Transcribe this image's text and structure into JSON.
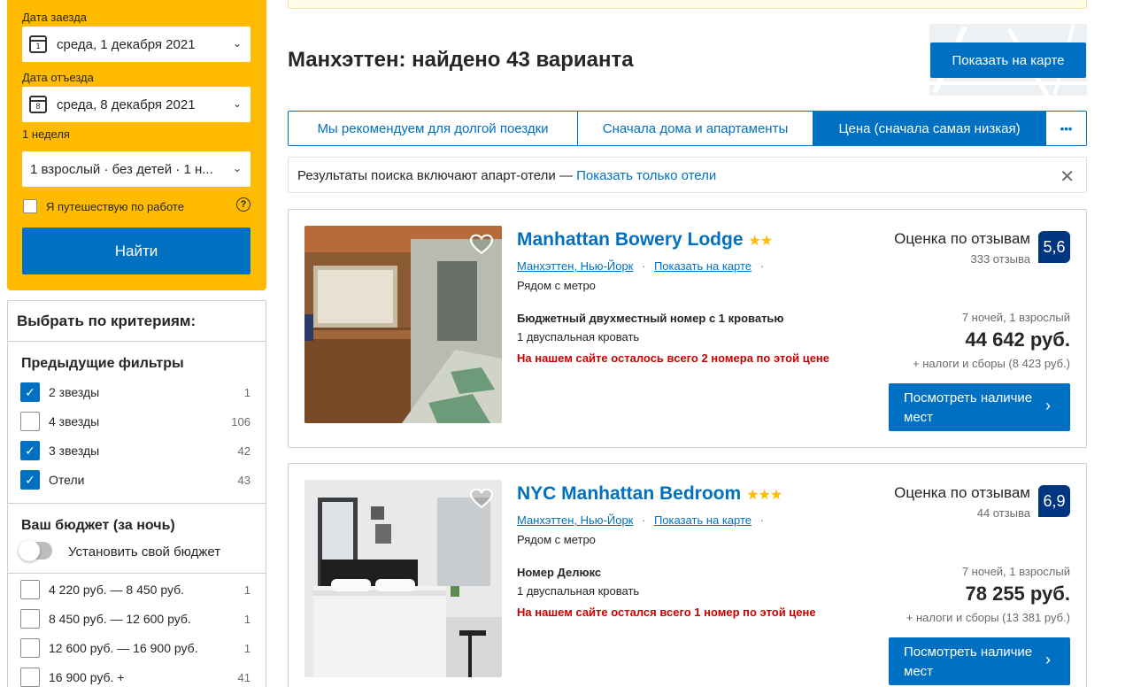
{
  "search": {
    "checkin_label": "Дата заезда",
    "checkin_value": "среда, 1 декабря 2021",
    "checkin_day": "1",
    "checkout_label": "Дата отъезда",
    "checkout_value": "среда, 8 декабря 2021",
    "checkout_day": "8",
    "duration": "1 неделя",
    "guests": "1 взрослый · без детей · 1 н...",
    "business_label": "Я путешествую по работе",
    "help": "?",
    "search_button": "Найти"
  },
  "filters": {
    "title": "Выбрать по критериям:",
    "previous_title": "Предыдущие фильтры",
    "previous": [
      {
        "label": "2 звезды",
        "count": "1",
        "checked": true
      },
      {
        "label": "4 звезды",
        "count": "106",
        "checked": false
      },
      {
        "label": "3 звезды",
        "count": "42",
        "checked": true
      },
      {
        "label": "Отели",
        "count": "43",
        "checked": true
      }
    ],
    "budget_title": "Ваш бюджет (за ночь)",
    "budget_toggle": "Установить свой бюджет",
    "budget": [
      {
        "label": "4 220 руб. — 8 450 руб.",
        "count": "1",
        "checked": false
      },
      {
        "label": "8 450 руб. — 12 600 руб.",
        "count": "1",
        "checked": false
      },
      {
        "label": "12 600 руб. — 16 900 руб.",
        "count": "1",
        "checked": false
      },
      {
        "label": "16 900 руб. +",
        "count": "41",
        "checked": false
      }
    ]
  },
  "header": {
    "title": "Манхэттен: найдено 43 варианта",
    "map_button": "Показать на карте"
  },
  "sort": {
    "tabs": [
      {
        "label": "Мы рекомендуем для долгой поездки"
      },
      {
        "label": "Сначала дома и апартаменты"
      },
      {
        "label": "Цена (сначала самая низкая)"
      },
      {
        "label": "•••"
      }
    ],
    "active_index": 2
  },
  "notice": {
    "text": "Результаты поиска включают апарт-отели — ",
    "link": "Показать только отели",
    "close": "✕"
  },
  "hotels": [
    {
      "name": "Manhattan Bowery Lodge",
      "stars": "★★",
      "district": "Манхэттен, Нью-Йорк",
      "map_link": "Показать на карте",
      "metro": "Рядом с метро",
      "room": "Бюджетный двухместный номер с 1 кроватью",
      "bed": "1 двуспальная кровать",
      "warning": "На нашем сайте осталось всего 2 номера по этой цене",
      "review_label": "Оценка по отзывам",
      "review_count": "333 отзыва",
      "score": "5,6",
      "nights": "7 ночей, 1 взрослый",
      "price": "44 642 руб.",
      "taxes": "+ налоги и сборы (8 423 руб.)",
      "button": "Посмотреть наличие мест"
    },
    {
      "name": "NYC Manhattan Bedroom",
      "stars": "★★★",
      "district": "Манхэттен, Нью-Йорк",
      "map_link": "Показать на карте",
      "metro": "Рядом с метро",
      "room": "Номер Делюкс",
      "bed": "1 двуспальная кровать",
      "warning": "На нашем сайте остался всего 1 номер по этой цене",
      "review_label": "Оценка по отзывам",
      "review_count": "44 отзыва",
      "score": "6,9",
      "nights": "7 ночей, 1 взрослый",
      "price": "78 255 руб.",
      "taxes": "+ налоги и сборы (13 381 руб.)",
      "button": "Посмотреть наличие мест"
    }
  ],
  "colors": {
    "brand_blue": "#0071c2",
    "search_yellow": "#febb02",
    "score_navy": "#003580",
    "warning_red": "#cc0000"
  }
}
